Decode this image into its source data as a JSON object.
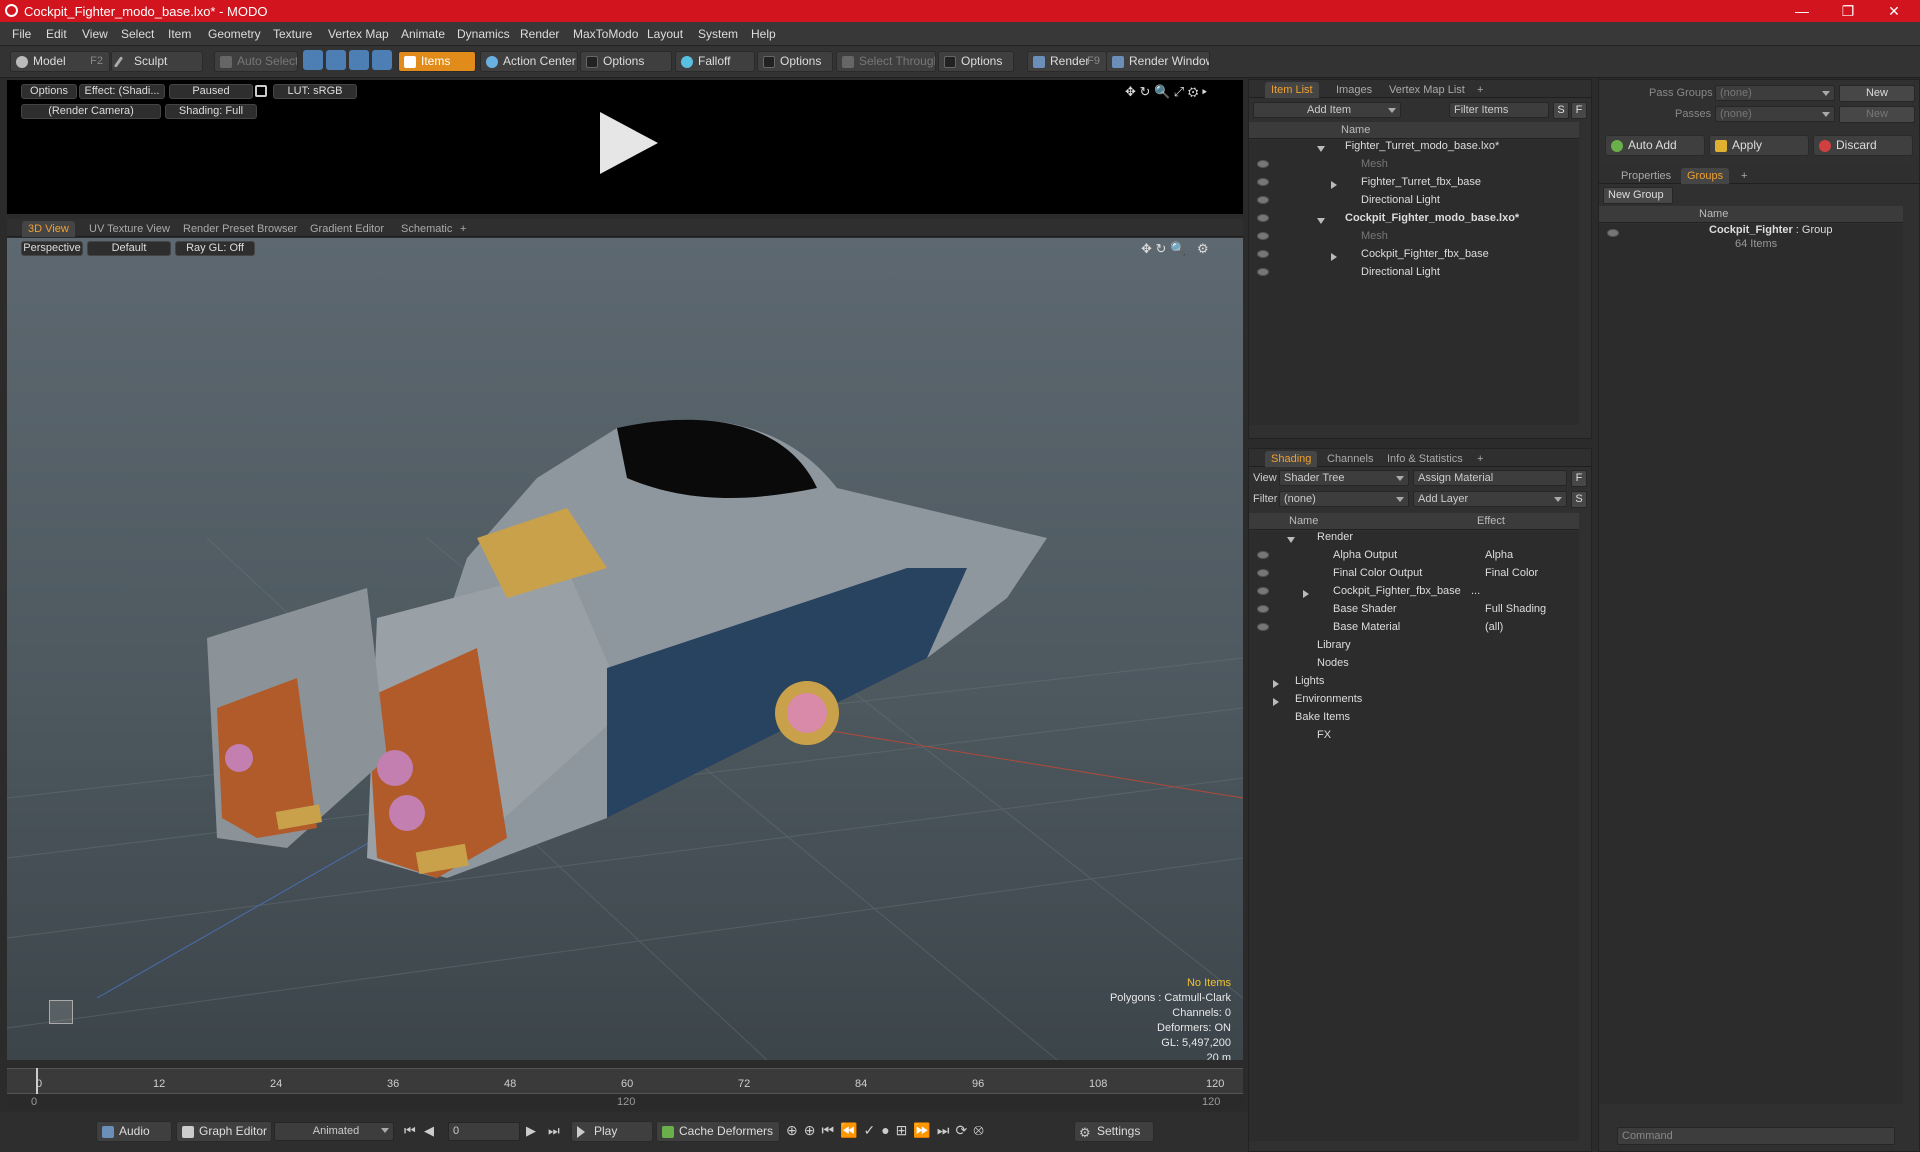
{
  "window": {
    "title": "Cockpit_Fighter_modo_base.lxo* - MODO",
    "minimize": "—",
    "restore": "❐",
    "close": "✕"
  },
  "menu": [
    "File",
    "Edit",
    "View",
    "Select",
    "Item",
    "Geometry",
    "Texture",
    "Vertex Map",
    "Animate",
    "Dynamics",
    "Render",
    "MaxToModo",
    "Layout",
    "System",
    "Help"
  ],
  "toolbar": {
    "model": "Model",
    "model_key": "F2",
    "sculpt": "Sculpt",
    "auto_select": "Auto Select",
    "items": "Items",
    "action_center": "Action Center",
    "options1": "Options",
    "falloff": "Falloff",
    "options2": "Options",
    "select_through": "Select Through",
    "options3": "Options",
    "render": "Render",
    "render_key": "F9",
    "render_window": "Render Window"
  },
  "preview": {
    "options": "Options",
    "effect": "Effect: (Shadi...",
    "paused": "Paused",
    "lut": "LUT: sRGB",
    "camera": "(Render Camera)",
    "shading": "Shading: Full"
  },
  "viewport_tabs": [
    "3D View",
    "UV Texture View",
    "Render Preset Browser",
    "Gradient Editor",
    "Schematic",
    "+"
  ],
  "viewport": {
    "projection": "Perspective",
    "style": "Default",
    "raygl": "Ray GL: Off"
  },
  "hud": {
    "no_items": "No Items",
    "polygons": "Polygons : Catmull-Clark",
    "channels": "Channels: 0",
    "deformers": "Deformers: ON",
    "gl": "GL: 5,497,200",
    "scale": "20 m"
  },
  "timeline": {
    "ticks": [
      "0",
      "12",
      "24",
      "36",
      "48",
      "60",
      "72",
      "84",
      "96",
      "108",
      "120"
    ],
    "start": "0",
    "mid": "120",
    "end": "120"
  },
  "transport": {
    "audio": "Audio",
    "graph_editor": "Graph Editor",
    "animated": "Animated",
    "frame": "0",
    "play": "Play",
    "cache": "Cache Deformers",
    "settings": "Settings"
  },
  "item_list": {
    "tabs": [
      "Item List",
      "Images",
      "Vertex Map List",
      "+"
    ],
    "add_item": "Add Item",
    "filter": "Filter Items",
    "s": "S",
    "f": "F",
    "col_name": "Name",
    "rows": [
      {
        "label": "Fighter_Turret_modo_base.lxo*",
        "bold": false
      },
      {
        "label": "Mesh",
        "dim": true
      },
      {
        "label": "Fighter_Turret_fbx_base"
      },
      {
        "label": "Directional Light"
      },
      {
        "label": "Cockpit_Fighter_modo_base.lxo*",
        "bold": true
      },
      {
        "label": "Mesh",
        "dim": true
      },
      {
        "label": "Cockpit_Fighter_fbx_base"
      },
      {
        "label": "Directional Light"
      }
    ]
  },
  "shading": {
    "tabs": [
      "Shading",
      "Channels",
      "Info & Statistics",
      "+"
    ],
    "view_label": "View",
    "view_value": "Shader Tree",
    "assign": "Assign Material",
    "f": "F",
    "filter_label": "Filter",
    "filter_value": "(none)",
    "add_layer": "Add Layer",
    "s": "S",
    "col_name": "Name",
    "col_effect": "Effect",
    "rows": [
      {
        "label": "Render",
        "effect": ""
      },
      {
        "label": "Alpha Output",
        "effect": "Alpha"
      },
      {
        "label": "Final Color Output",
        "effect": "Final Color"
      },
      {
        "label": "Cockpit_Fighter_fbx_base",
        "effect": "..."
      },
      {
        "label": "Base Shader",
        "effect": "Full Shading"
      },
      {
        "label": "Base Material",
        "effect": "(all)"
      },
      {
        "label": "Library",
        "effect": ""
      },
      {
        "label": "Nodes",
        "effect": ""
      },
      {
        "label": "Lights",
        "effect": ""
      },
      {
        "label": "Environments",
        "effect": ""
      },
      {
        "label": "Bake Items",
        "effect": ""
      },
      {
        "label": "FX",
        "effect": ""
      }
    ]
  },
  "groups": {
    "pass_groups": "Pass Groups",
    "pass_value": "(none)",
    "new": "New",
    "passes": "Passes",
    "passes_value": "(none)",
    "new2": "New",
    "auto_add": "Auto Add",
    "apply": "Apply",
    "discard": "Discard",
    "tabs": [
      "Properties",
      "Groups",
      "+"
    ],
    "new_group": "New Group",
    "col_name": "Name",
    "group_name": "Cockpit_Fighter",
    "group_type": ": Group",
    "group_count": "64 Items"
  },
  "command": {
    "placeholder": "Command"
  },
  "colors": {
    "title": "#d2141e",
    "accent": "#e08b1a"
  }
}
